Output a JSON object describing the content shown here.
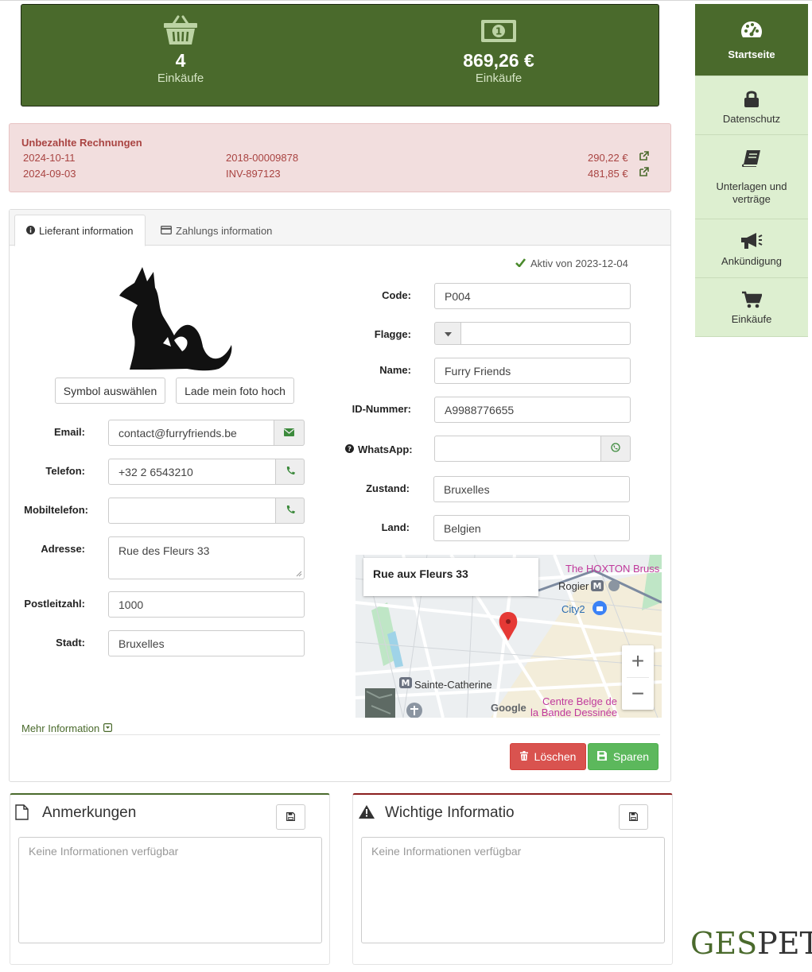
{
  "stats": {
    "purchases_count": "4",
    "purchases_label": "Einkäufe",
    "amount": "869,26 €",
    "amount_label": "Einkäufe"
  },
  "unpaid": {
    "title": "Unbezahlte Rechnungen",
    "rows": [
      {
        "date": "2024-10-11",
        "number": "2018-00009878",
        "amount": "290,22 €"
      },
      {
        "date": "2024-09-03",
        "number": "INV-897123",
        "amount": "481,85 €"
      }
    ]
  },
  "tabs": [
    {
      "label": "Lieferant information",
      "icon": "info-circle-icon"
    },
    {
      "label": "Zahlungs information",
      "icon": "credit-card-icon"
    }
  ],
  "status": "Aktiv von 2023-12-04",
  "buttons": {
    "choose_symbol": "Symbol auswählen",
    "upload_photo": "Lade mein foto hoch",
    "delete": "Löschen",
    "save": "Sparen"
  },
  "left_fields": {
    "email_label": "Email:",
    "email_value": "contact@furryfriends.be",
    "phone_label": "Telefon:",
    "phone_value": "+32 2 6543210",
    "mobile_label": "Mobiltelefon:",
    "mobile_value": "",
    "address_label": "Adresse:",
    "address_value": "Rue des Fleurs 33",
    "postal_label": "Postleitzahl:",
    "postal_value": "1000",
    "city_label": "Stadt:",
    "city_value": "Bruxelles"
  },
  "right_fields": {
    "code_label": "Code:",
    "code_value": "P004",
    "flag_label": "Flagge:",
    "flag_value": "",
    "name_label": "Name:",
    "name_value": "Furry Friends",
    "id_label": "ID-Nummer:",
    "id_value": "A9988776655",
    "whatsapp_label": "WhatsApp:",
    "whatsapp_value": "",
    "state_label": "Zustand:",
    "state_value": "Bruxelles",
    "country_label": "Land:",
    "country_value": "Belgien"
  },
  "map": {
    "card_title": "Rue aux Fleurs 33",
    "labels": {
      "hoxton": "The HOXTON Bruss",
      "rogier": "Rogier",
      "city2": "City2",
      "sainte_catherine": "Sainte-Catherine",
      "centre_belge_1": "Centre Belge de",
      "centre_belge_2": "la Bande Dessinée",
      "google": "Google"
    },
    "zoom_in": "+",
    "zoom_out": "−"
  },
  "more_info": "Mehr Information",
  "notes": [
    {
      "title": "Anmerkungen",
      "placeholder": "Keine Informationen verfügbar"
    },
    {
      "title": "Wichtige Informatio",
      "placeholder": "Keine Informationen verfügbar"
    }
  ],
  "sidebar": [
    {
      "label": "Startseite",
      "icon": "dashboard-icon",
      "active": true
    },
    {
      "label": "Datenschutz",
      "icon": "lock-icon",
      "active": false
    },
    {
      "label": "Unterlagen und verträge",
      "icon": "book-icon",
      "active": false
    },
    {
      "label": "Ankündigung",
      "icon": "megaphone-icon",
      "active": false
    },
    {
      "label": "Einkäufe",
      "icon": "cart-icon",
      "active": false
    }
  ],
  "logo": {
    "part1": "GES",
    "part2": "PET"
  },
  "colors": {
    "brand_green": "#4a6a2c",
    "sidebar_bg": "#ddefd0",
    "danger": "#d9534f",
    "success": "#5cb85c",
    "alert_bg": "#f2dede",
    "alert_text": "#a94442"
  }
}
